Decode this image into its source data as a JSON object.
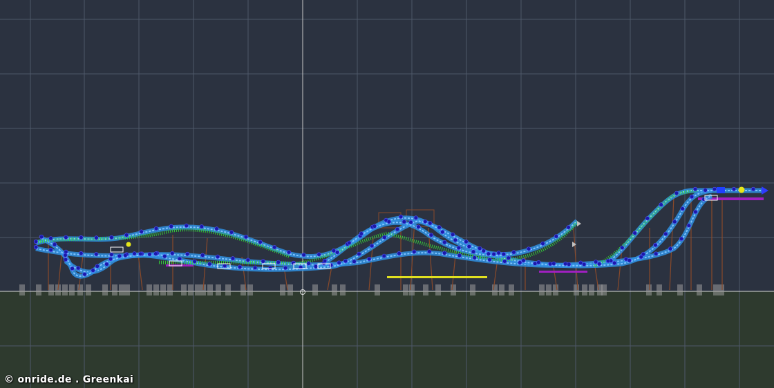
{
  "viewport": {
    "sky_color": "#2b3240",
    "ground_color": "#2e3a2e",
    "grid_color": "#4e5869",
    "horizon_color": "#d9d9d9",
    "origin_axis_color": "#c8c8c8"
  },
  "track": {
    "rail_color": "#2f8fe0",
    "rail_highlight": "#7fc4ff",
    "wire_color": "#36e036",
    "node_color": "#1a1aa8",
    "support_color": "#8a4a2a",
    "footer_color": "#9a9a9a",
    "brake_color": "#a020c0",
    "station_color": "#e0e020",
    "end_marker_color": "#e6e619"
  },
  "watermark": {
    "text": "© onride.de . Greenkai"
  }
}
